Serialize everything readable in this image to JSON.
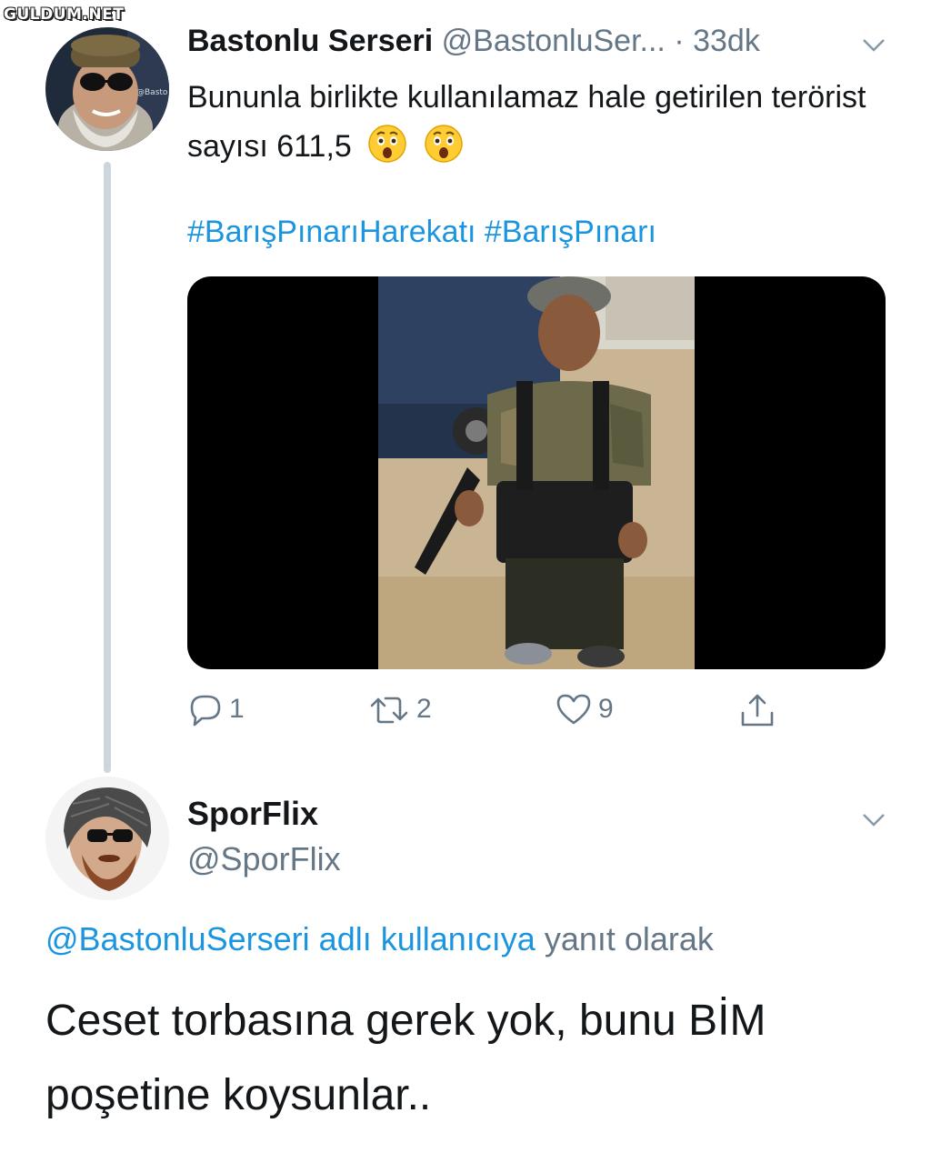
{
  "watermark": "GULDUM.NET",
  "tweet": {
    "author_name": "Bastonlu Serseri",
    "author_handle": "@BastonluSer...",
    "time": "· 33dk",
    "text": "Bununla birlikte kullanılamaz hale getirilen terörist sayısı 611,5",
    "emojis": [
      "astonished-face",
      "astonished-face"
    ],
    "hashtags": "#BarışPınarıHarekatı #BarışPınarı",
    "avatar_caption": "@Basto",
    "actions": {
      "replies": "1",
      "retweets": "2",
      "likes": "9"
    }
  },
  "reply": {
    "author_name": "SporFlix",
    "author_handle": "@SporFlix",
    "replying_mention": "@BastonluSerseri adlı kullanıcıya",
    "replying_suffix": "yanıt olarak",
    "text": "Ceset torbasına gerek yok, bunu BİM poşetine koysunlar.."
  },
  "colors": {
    "link": "#1b95e0",
    "muted": "#657786",
    "text": "#14171a",
    "thread_line": "#cdd6dd"
  }
}
